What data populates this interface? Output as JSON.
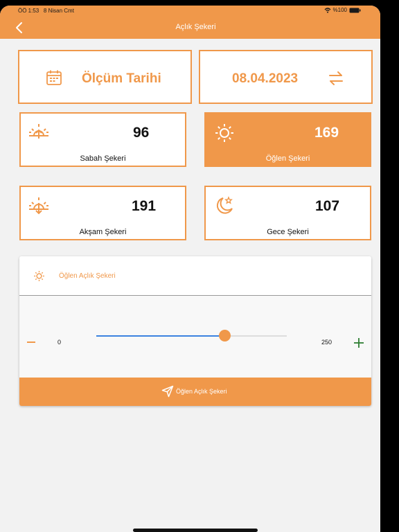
{
  "status_bar": {
    "time": "ÖÖ 1:53",
    "date": "8 Nisan Cmt",
    "battery": "%100"
  },
  "header": {
    "title": "Açlık Şekeri",
    "back_icon": "chevron-left-icon"
  },
  "date_card": {
    "label": "Ölçüm Tarihi",
    "value": "08.04.2023",
    "icon": "calendar-icon",
    "swap_icon": "swap-arrows-icon"
  },
  "readings": [
    {
      "label": "Sabah Şekeri",
      "value": "96",
      "icon": "sunrise-icon",
      "selected": false
    },
    {
      "label": "Öğlen Şekeri",
      "value": "169",
      "icon": "sun-icon",
      "selected": true
    },
    {
      "label": "Akşam Şekeri",
      "value": "191",
      "icon": "sunset-icon",
      "selected": false
    },
    {
      "label": "Gece Şekeri",
      "value": "107",
      "icon": "moon-star-icon",
      "selected": false
    }
  ],
  "panel": {
    "title": "Öğlen Açlık Şekeri",
    "icon": "sun-icon",
    "slider": {
      "min": "0",
      "max": "250",
      "value": 169
    },
    "minus_icon": "minus-icon",
    "plus_icon": "plus-icon",
    "send_label": "Öğlen Açlık Şekeri",
    "send_icon": "send-icon"
  },
  "colors": {
    "accent": "#f0984a",
    "slider": "#3b82e0",
    "background": "#f2f2f2",
    "plus": "#2e7d32"
  }
}
